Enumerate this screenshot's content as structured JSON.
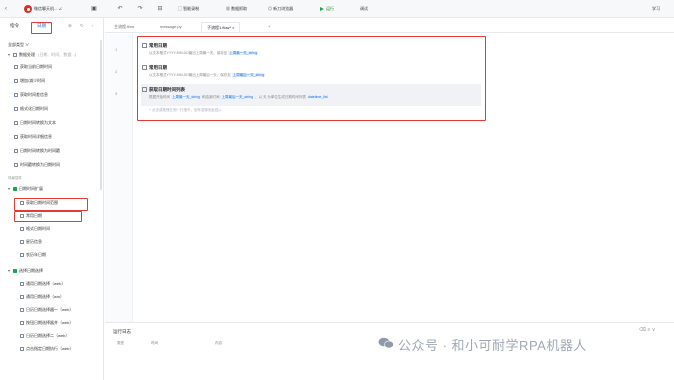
{
  "toolbar": {
    "app_title": "微信聊天机... ∠",
    "undo": "↶",
    "redo": "↷",
    "smart_record": "智能录制",
    "data_crawl": "数据抓取",
    "new_browser": "新刀浏览器",
    "run": "运行",
    "debug": "调试",
    "right_label": "学习"
  },
  "sidebar": {
    "tab_instructions": "指令",
    "tab_date": "日期",
    "filter": "全部类型 ∨",
    "data_panel": "数据处理",
    "data_panel_hint": "(日期、时间、数据...)",
    "items": [
      "获取当前日期时间",
      "增加/减少时间",
      "获取时间差信息",
      "格式化日期时间",
      "日期时间转换为文本",
      "获取时间详细信息",
      "日期时间转换为时间戳",
      "时间戳转换为日期时间"
    ],
    "section_scene": "场景插件",
    "group_ext": "日期时间扩展",
    "ext_items": [
      "获取日期时间范围",
      "常用日期",
      "格式日期时间",
      "星历信息",
      "农历年日期"
    ],
    "group_pick": "选择日期选择",
    "pick_items": [
      "通用日期选择（web）",
      "通用日期选择（win）",
      "日历日期选择器一（web）",
      "按钮日期选择器并（web）",
      "日历日期选择二（web）",
      "点击指定日期执行（web）"
    ]
  },
  "file_tabs": [
    "主流程.flow",
    "message.py",
    "子流程1.flow*",
    "×",
    "+"
  ],
  "editor": {
    "line_numbers": [
      "1",
      "2",
      "3"
    ],
    "steps": [
      {
        "title": "常用日期",
        "desc_pre": "以文本格式YYYY-MM-DD输出上周最一天，保存至",
        "pill": "上周最一天_string"
      },
      {
        "title": "常用日期",
        "desc_pre": "以文本格式YYYY-MM-DD输出上周最后一天，保存至",
        "pill": "上周最后一天_string"
      },
      {
        "title": "获取日期时间列表",
        "desc_pre": "根据开始时间",
        "pill": "上周最一天_string",
        "desc_mid": "和结束时间",
        "pill2": "上周最后一天_string",
        "desc_tail": "，以 天 为单位生成日期时间列表",
        "pill3": "datetime_list"
      }
    ],
    "add_hint": "+ 点击或拖拽左侧一行指令，回车选择到此插入"
  },
  "log": {
    "title": "运行日志",
    "col_type": "类型",
    "col_time": "时间",
    "col_content": "内容",
    "ctrl_icons": "⌫ ≡ ∨"
  },
  "watermark": "公众号 · 和小可耐学RPA机器人"
}
